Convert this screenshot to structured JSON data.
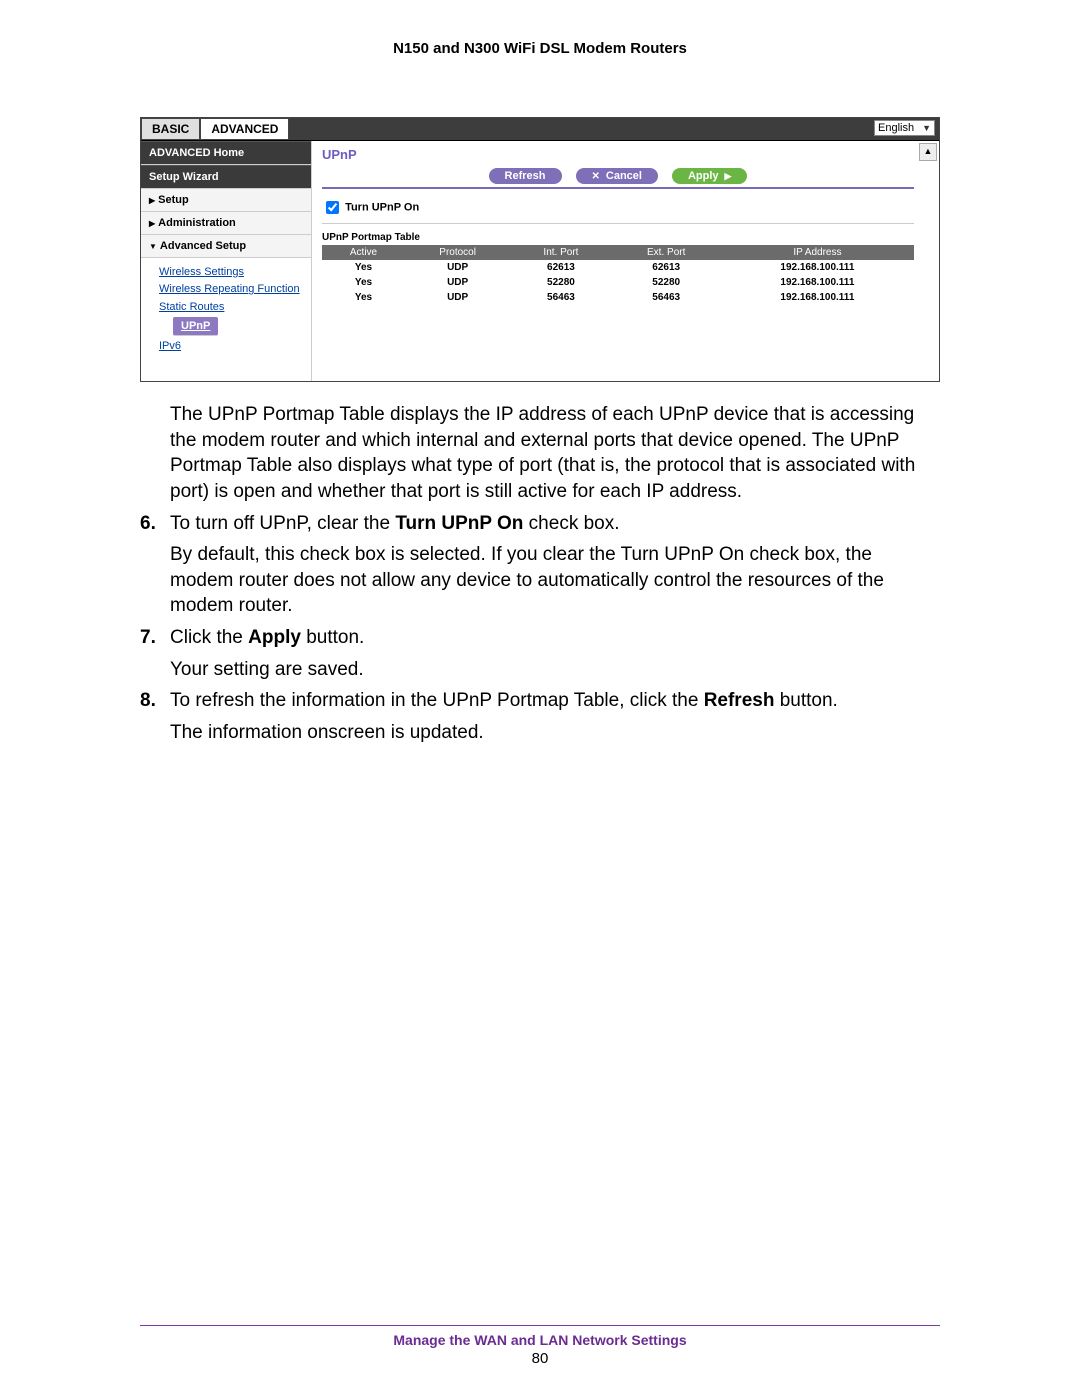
{
  "doc": {
    "title": "N150 and N300 WiFi DSL Modem Routers",
    "footer_section": "Manage the WAN and LAN Network Settings",
    "page_number": "80"
  },
  "ui": {
    "tabs": {
      "basic": "BASIC",
      "advanced": "ADVANCED"
    },
    "language": "English",
    "sidebar": {
      "adv_home": "ADVANCED Home",
      "setup_wizard": "Setup Wizard",
      "setup": "Setup",
      "administration": "Administration",
      "advanced_setup": "Advanced Setup",
      "sub": {
        "wireless_settings": "Wireless Settings",
        "wireless_repeating": "Wireless Repeating Function",
        "static_routes": "Static Routes",
        "upnp": "UPnP",
        "ipv6": "IPv6"
      }
    },
    "panel": {
      "title": "UPnP",
      "btn_refresh": "Refresh",
      "btn_cancel": "Cancel",
      "btn_apply": "Apply",
      "checkbox_label": "Turn UPnP On",
      "table_caption": "UPnP Portmap Table",
      "headers": {
        "active": "Active",
        "protocol": "Protocol",
        "int_port": "Int. Port",
        "ext_port": "Ext. Port",
        "ip": "IP Address"
      },
      "rows": [
        {
          "active": "Yes",
          "protocol": "UDP",
          "int": "62613",
          "ext": "62613",
          "ip": "192.168.100.111"
        },
        {
          "active": "Yes",
          "protocol": "UDP",
          "int": "52280",
          "ext": "52280",
          "ip": "192.168.100.111"
        },
        {
          "active": "Yes",
          "protocol": "UDP",
          "int": "56463",
          "ext": "56463",
          "ip": "192.168.100.111"
        }
      ]
    }
  },
  "text": {
    "intro": "The UPnP Portmap Table displays the IP address of each UPnP device that is accessing the modem router and which internal and external ports that device opened. The UPnP Portmap Table also displays what type of port (that is, the protocol that is associated with port) is open and whether that port is still active for each IP address.",
    "step6_num": "6.",
    "step6_a": "To turn off UPnP, clear the ",
    "step6_b": "Turn UPnP On",
    "step6_c": " check box.",
    "step6_body": "By default, this check box is selected. If you clear the Turn UPnP On check box, the modem router does not allow any device to automatically control the resources of the modem router.",
    "step7_num": "7.",
    "step7_a": "Click the ",
    "step7_b": "Apply",
    "step7_c": " button.",
    "step7_body": "Your setting are saved.",
    "step8_num": "8.",
    "step8_a": "To refresh the information in the UPnP Portmap Table, click the ",
    "step8_b": "Refresh",
    "step8_c": " button.",
    "step8_body": "The information onscreen is updated."
  }
}
